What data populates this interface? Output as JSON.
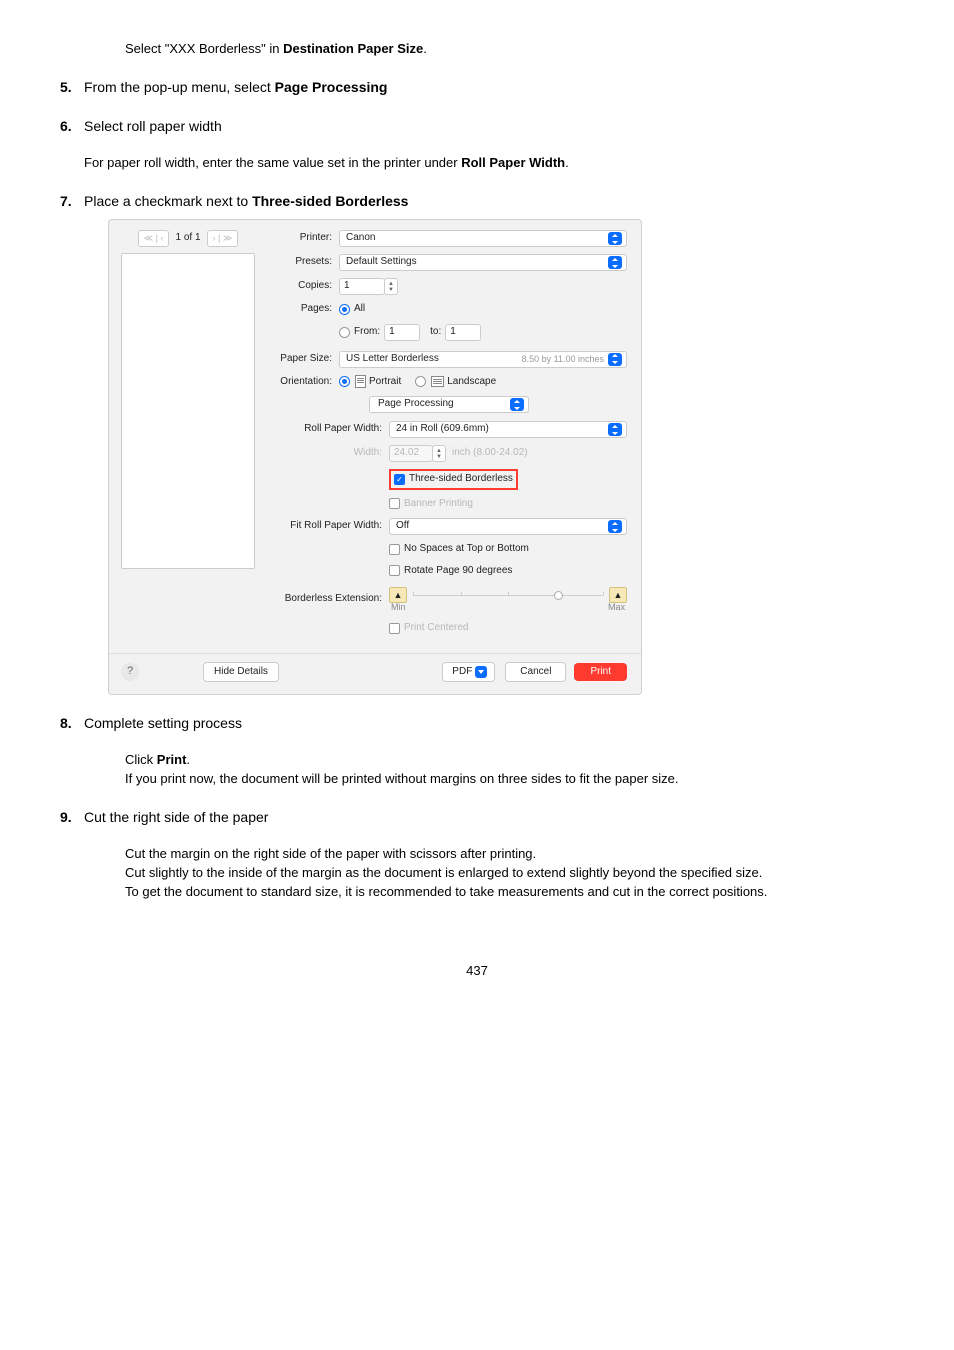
{
  "intro_prefix": "Select \"XXX Borderless\" in ",
  "intro_bold": "Destination Paper Size",
  "intro_suffix": ".",
  "steps": {
    "s5": {
      "num": "5.",
      "prefix": "From the pop-up menu, select ",
      "bold": "Page Processing"
    },
    "s6": {
      "num": "6.",
      "title": "Select roll paper width",
      "sub_prefix": "For paper roll width, enter the same value set in the printer under ",
      "sub_bold": "Roll Paper Width",
      "sub_suffix": "."
    },
    "s7": {
      "num": "7.",
      "prefix": "Place a checkmark next to ",
      "bold": "Three-sided Borderless"
    },
    "s8": {
      "num": "8.",
      "title": "Complete setting process",
      "l1_prefix": "Click ",
      "l1_bold": "Print",
      "l1_suffix": ".",
      "l2": "If you print now, the document will be printed without margins on three sides to fit the paper size."
    },
    "s9": {
      "num": "9.",
      "title": "Cut the right side of the paper",
      "p1": "Cut the margin on the right side of the paper with scissors after printing.",
      "p2": "Cut slightly to the inside of the margin as the document is enlarged to extend slightly beyond the specified size.",
      "p3": "To get the document to standard size, it is recommended to take measurements and cut in the correct positions."
    }
  },
  "dialog": {
    "page_of": "1 of 1",
    "printer_lbl": "Printer:",
    "printer_val": "Canon",
    "presets_lbl": "Presets:",
    "presets_val": "Default Settings",
    "copies_lbl": "Copies:",
    "copies_val": "1",
    "pages_lbl": "Pages:",
    "all": "All",
    "from_lbl": "From:",
    "from_val": "1",
    "to_lbl": "to:",
    "to_val": "1",
    "paper_size_lbl": "Paper Size:",
    "paper_size_val": "US Letter Borderless",
    "paper_size_sub": "8.50 by 11.00 inches",
    "orientation_lbl": "Orientation:",
    "portrait": "Portrait",
    "landscape": "Landscape",
    "section": "Page Processing",
    "roll_width_lbl": "Roll Paper Width:",
    "roll_width_val": "24 in Roll (609.6mm)",
    "width_lbl": "Width:",
    "width_val": "24.02",
    "width_unit": "inch (8.00-24.02)",
    "three_sided": "Three-sided Borderless",
    "banner": "Banner Printing",
    "fit_roll_lbl": "Fit Roll Paper Width:",
    "fit_roll_val": "Off",
    "no_spaces": "No Spaces at Top or Bottom",
    "rotate90": "Rotate Page 90 degrees",
    "borderless_ext_lbl": "Borderless Extension:",
    "min": "Min",
    "max": "Max",
    "print_centered": "Print Centered",
    "help": "?",
    "hide_details": "Hide Details",
    "pdf": "PDF",
    "cancel": "Cancel",
    "print": "Print"
  },
  "page_number": "437"
}
